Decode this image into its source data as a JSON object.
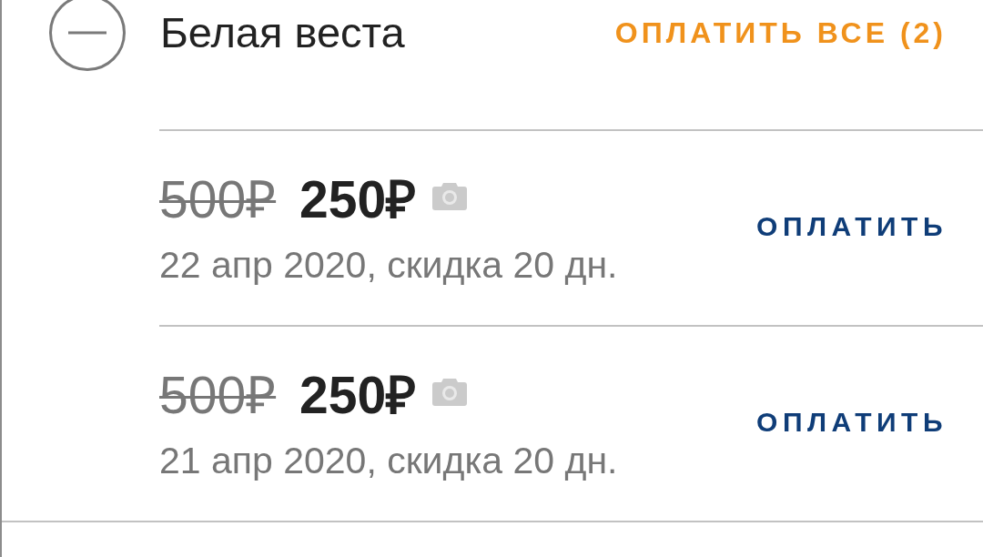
{
  "group": {
    "title": "Белая веста",
    "expanded": true,
    "pay_all_button": "ОПЛАТИТЬ ВСЕ (2)"
  },
  "fines": [
    {
      "old_price": "500₽",
      "price": "250₽",
      "has_photo": true,
      "details": "22 апр 2020, скидка 20 дн.",
      "pay_button": "ОПЛАТИТЬ"
    },
    {
      "old_price": "500₽",
      "price": "250₽",
      "has_photo": true,
      "details": "21 апр 2020, скидка 20 дн.",
      "pay_button": "ОПЛАТИТЬ"
    }
  ]
}
